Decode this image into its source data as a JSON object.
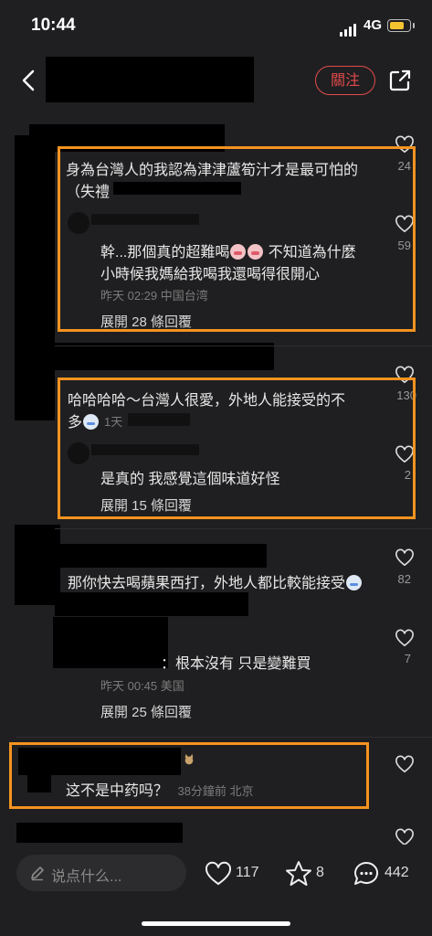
{
  "status": {
    "time": "10:44",
    "network": "4G"
  },
  "header": {
    "follow_label": "關注"
  },
  "comments": [
    {
      "text_line1": "身為台灣人的我認為津津蘆筍汁才是最可怕的",
      "text_line2": "（失禮",
      "likes": "24",
      "reply": {
        "line1_prefix": "幹...那個真的超難喝",
        "line1_suffix": "不知道為什麼",
        "line2": "小時候我媽給我喝我還喝得很開心",
        "meta": "昨天 02:29 中国台湾",
        "likes": "59"
      },
      "expand": "展開 28 條回覆"
    },
    {
      "text_line1": "哈哈哈哈～台灣人很愛，外地人能接受的不",
      "text_line2": "多",
      "meta": "1天",
      "likes": "130",
      "reply": {
        "line1": "是真的 我感覺這個味道好怪",
        "likes": "2"
      },
      "expand": "展開 15 條回覆"
    },
    {
      "text": "那你快去喝蘋果西打，外地人都比較能接受",
      "likes": "82",
      "reply": {
        "text": "：根本沒有 只是變難買",
        "meta": "昨天 00:45 美国",
        "likes": "7"
      },
      "expand": "展開 25 條回覆"
    },
    {
      "text": "这不是中药吗？",
      "meta": "38分鐘前 北京"
    }
  ],
  "bottom_bar": {
    "placeholder": "说点什么...",
    "likes": "117",
    "stars": "8",
    "comments": "442"
  },
  "icons": {
    "back": "chevron-left-icon",
    "share": "share-icon",
    "like": "heart-icon",
    "star": "star-icon",
    "comment": "comment-bubble-icon",
    "pencil": "pencil-icon"
  },
  "colors": {
    "accent_red": "#e34b4b",
    "highlight_orange": "#f4931f",
    "background": "#1f1f21"
  }
}
